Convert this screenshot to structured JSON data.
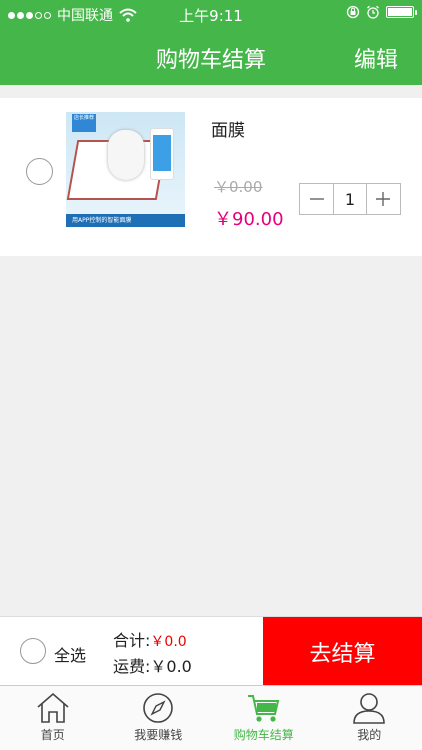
{
  "status_bar": {
    "carrier": "中国联通",
    "time": "上午9:11"
  },
  "nav": {
    "title": "购物车结算",
    "edit_label": "编辑"
  },
  "cart": {
    "items": [
      {
        "name": "面膜",
        "original_price": "￥0.00",
        "price": "￥90.00",
        "quantity": "1",
        "image_text": "用APP控制的智能面膜",
        "image_tag": "店长推荐"
      }
    ]
  },
  "checkout": {
    "select_all_label": "全选",
    "total_label": "合计:",
    "total_value": "￥0.0",
    "shipping_label": "运费:",
    "shipping_value": "￥0.0",
    "checkout_button": "去结算"
  },
  "tabbar": {
    "tabs": [
      {
        "label": "首页",
        "icon": "home-icon"
      },
      {
        "label": "我要赚钱",
        "icon": "compass-icon"
      },
      {
        "label": "购物车结算",
        "icon": "cart-icon"
      },
      {
        "label": "我的",
        "icon": "user-icon"
      }
    ],
    "active_index": 2
  },
  "colors": {
    "primary": "#45b649",
    "price": "#e6007e",
    "checkout_button": "#ff0000"
  }
}
